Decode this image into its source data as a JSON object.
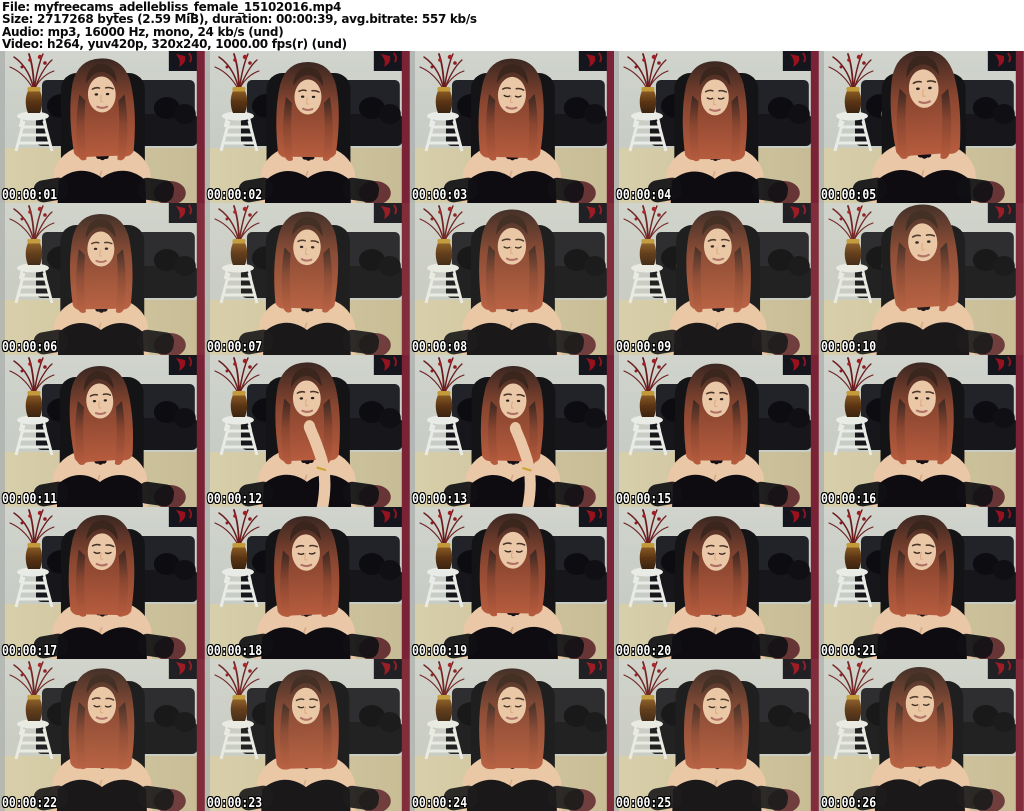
{
  "header": {
    "lines": [
      "File: myfreecams_adellebliss_female_15102016.mp4",
      "Size: 2717268 bytes (2.59 MiB), duration: 00:00:39, avg.bitrate: 557 kb/s",
      "Audio: mp3, 16000 Hz, mono, 24 kb/s (und)",
      "Video: h264, yuv420p, 320x240, 1000.00 fps(r) (und)"
    ]
  },
  "grid": {
    "columns": 5,
    "rows": 5,
    "frames": [
      {
        "timestamp": "00:00:01"
      },
      {
        "timestamp": "00:00:02"
      },
      {
        "timestamp": "00:00:03"
      },
      {
        "timestamp": "00:00:04"
      },
      {
        "timestamp": "00:00:05"
      },
      {
        "timestamp": "00:00:06"
      },
      {
        "timestamp": "00:00:07"
      },
      {
        "timestamp": "00:00:08"
      },
      {
        "timestamp": "00:00:09"
      },
      {
        "timestamp": "00:00:10"
      },
      {
        "timestamp": "00:00:11"
      },
      {
        "timestamp": "00:00:12"
      },
      {
        "timestamp": "00:00:13"
      },
      {
        "timestamp": "00:00:15"
      },
      {
        "timestamp": "00:00:16"
      },
      {
        "timestamp": "00:00:17"
      },
      {
        "timestamp": "00:00:18"
      },
      {
        "timestamp": "00:00:19"
      },
      {
        "timestamp": "00:00:20"
      },
      {
        "timestamp": "00:00:21"
      },
      {
        "timestamp": "00:00:22"
      },
      {
        "timestamp": "00:00:23"
      },
      {
        "timestamp": "00:00:24"
      },
      {
        "timestamp": "00:00:25"
      },
      {
        "timestamp": "00:00:26"
      }
    ]
  },
  "colors": {
    "header_bg": "#ffffff",
    "header_text": "#0a0a0a",
    "timestamp_text": "#ffffff",
    "timestamp_outline": "#000000",
    "wall": "#c9cdc6",
    "floor": "#cec49f",
    "right_strip": "#7b2336",
    "left_strip": "#aeb3b0",
    "sofa_dark": "#222328",
    "pillow_accent": "#a8691f",
    "shelf_white": "#e9ebe6",
    "branches": "#6b1d1e",
    "hair_root": "#3a2722",
    "hair_mid": "#8a4630",
    "hair_tip": "#b75c3e",
    "skin": "#eac7a6",
    "top_black": "#0e0c11",
    "chair_black": "#141417"
  }
}
